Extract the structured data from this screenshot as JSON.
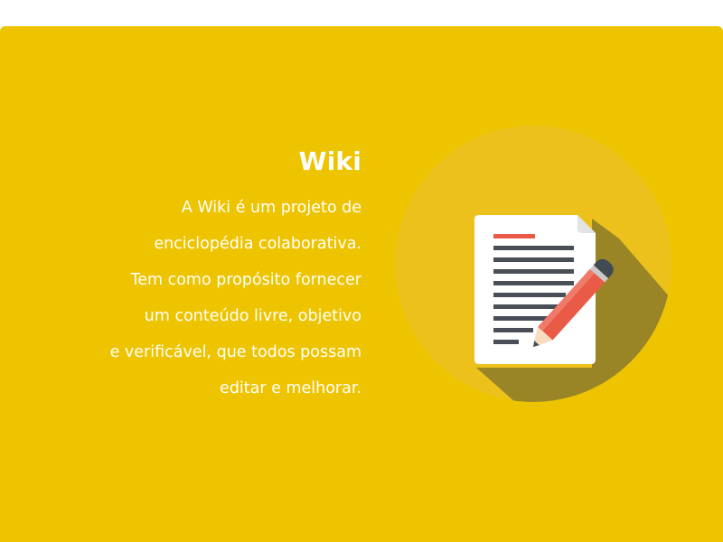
{
  "colors": {
    "background": "#eec400",
    "circle": "#ecc11c",
    "shadow": "#9a8526",
    "paper": "#ffffff",
    "paper_fold": "#e3e3e3",
    "lines": "#4a4f57",
    "accent_line": "#e95a47",
    "pencil_body": "#e95a47",
    "pencil_stripe": "#f07a6a",
    "pencil_eraser": "#424a52",
    "pencil_wood": "#f8dcc0",
    "text": "#ffffff"
  },
  "card": {
    "title": "Wiki",
    "description_lines": [
      "A Wiki é um projeto de",
      "enciclopédia colaborativa.",
      "Tem como propósito fornecer",
      "um conteúdo livre, objetivo",
      "e verificável, que todos possam",
      "editar e melhorar."
    ]
  },
  "icons": {
    "illustration": "document-with-pencil-icon"
  }
}
